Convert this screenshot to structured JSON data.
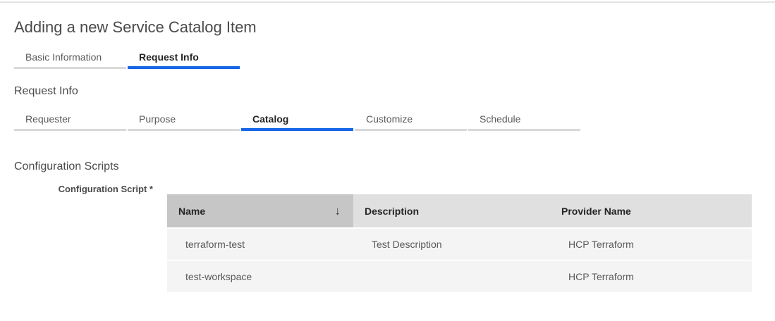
{
  "page": {
    "title": "Adding a new Service Catalog Item"
  },
  "main_tabs": {
    "items": [
      {
        "label": "Basic Information",
        "active": false
      },
      {
        "label": "Request Info",
        "active": true
      }
    ]
  },
  "request_info": {
    "heading": "Request Info",
    "tabs": [
      {
        "label": "Requester",
        "active": false
      },
      {
        "label": "Purpose",
        "active": false
      },
      {
        "label": "Catalog",
        "active": true
      },
      {
        "label": "Customize",
        "active": false
      },
      {
        "label": "Schedule",
        "active": false
      }
    ]
  },
  "configuration_scripts": {
    "heading": "Configuration Scripts",
    "field_label": "Configuration Script *",
    "table": {
      "columns": [
        {
          "label": "Name",
          "sorted": true,
          "sort_icon": "↓",
          "sort_direction": "descending"
        },
        {
          "label": "Description",
          "sorted": false
        },
        {
          "label": "Provider Name",
          "sorted": false
        }
      ],
      "rows": [
        {
          "name": "terraform-test",
          "description": "Test Description",
          "provider_name": "HCP Terraform"
        },
        {
          "name": "test-workspace",
          "description": "",
          "provider_name": "HCP Terraform"
        }
      ]
    }
  },
  "colors": {
    "accent_blue": "#1766e8",
    "inactive_tab_underline": "#d9d9d9",
    "sorted_header_bg": "#c6c6c6",
    "header_bg": "#e0e0e0",
    "row_bg": "#f4f4f4",
    "title_text": "#4a4a4a",
    "cell_text": "#595959",
    "header_text": "#252525"
  }
}
